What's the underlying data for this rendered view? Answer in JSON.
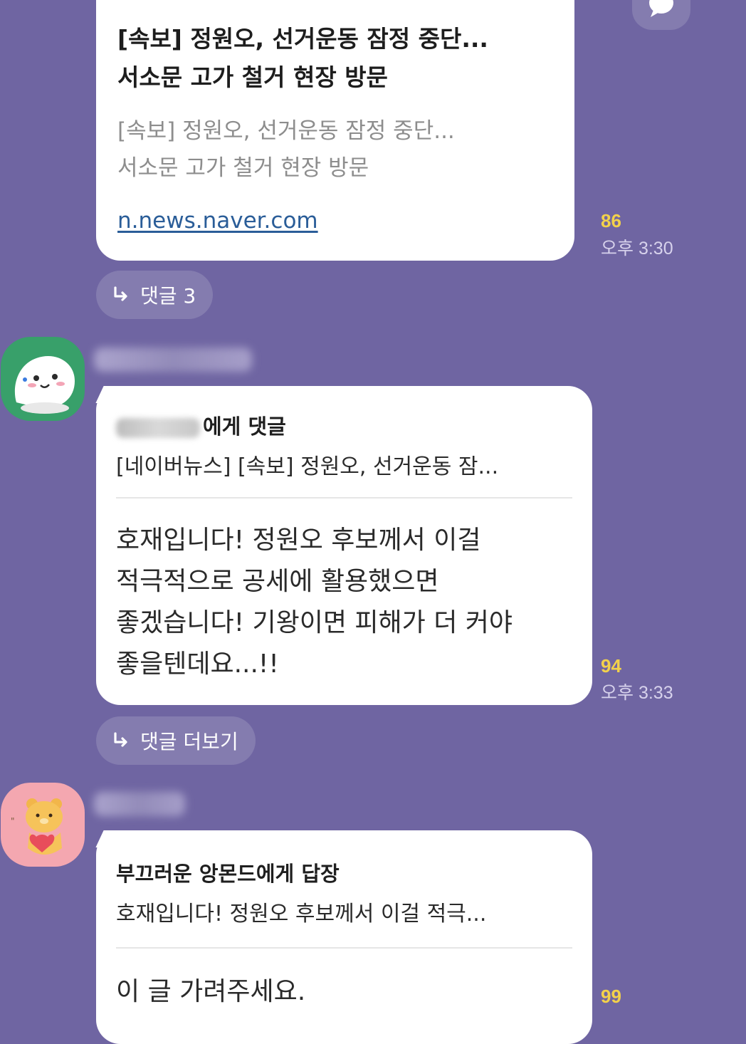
{
  "news_card": {
    "title_line1": "[속보] 정원오, 선거운동 잠정 중단...",
    "title_line2": "서소문 고가 철거 현장 방문",
    "desc_line1": "[속보] 정원오, 선거운동 잠정 중단...",
    "desc_line2": "서소문 고가 철거 현장 방문",
    "link": "n.news.naver.com",
    "unread_count": "86",
    "time": "오후 3:30"
  },
  "thread_pill_1": {
    "label": "댓글 3"
  },
  "comment_1": {
    "header_suffix": "에게 댓글",
    "quote": "[네이버뉴스] [속보] 정원오, 선거운동 잠...",
    "body_line1": "호재입니다! 정원오 후보께서 이걸",
    "body_line2": "적극적으로 공세에 활용했으면",
    "body_line3": "좋겠습니다! 기왕이면 피해가 더 커야",
    "body_line4": "좋을텐데요...!!",
    "unread_count": "94",
    "time": "오후 3:33"
  },
  "thread_pill_2": {
    "label": "댓글 더보기"
  },
  "reply_1": {
    "header": "부끄러운 앙몬드에게 답장",
    "quote": "호재입니다! 정원오 후보께서 이걸 적극...",
    "body": "이 글 가려주세요.",
    "unread_count": "99"
  },
  "colors": {
    "background": "#6f65a2",
    "bubble": "#ffffff",
    "unread": "#f2d14b",
    "link": "#2a5d98"
  },
  "icons": [
    "reply-arrow-icon",
    "chat-bubble-icon",
    "avatar-ghost-icon",
    "avatar-bear-icon"
  ]
}
